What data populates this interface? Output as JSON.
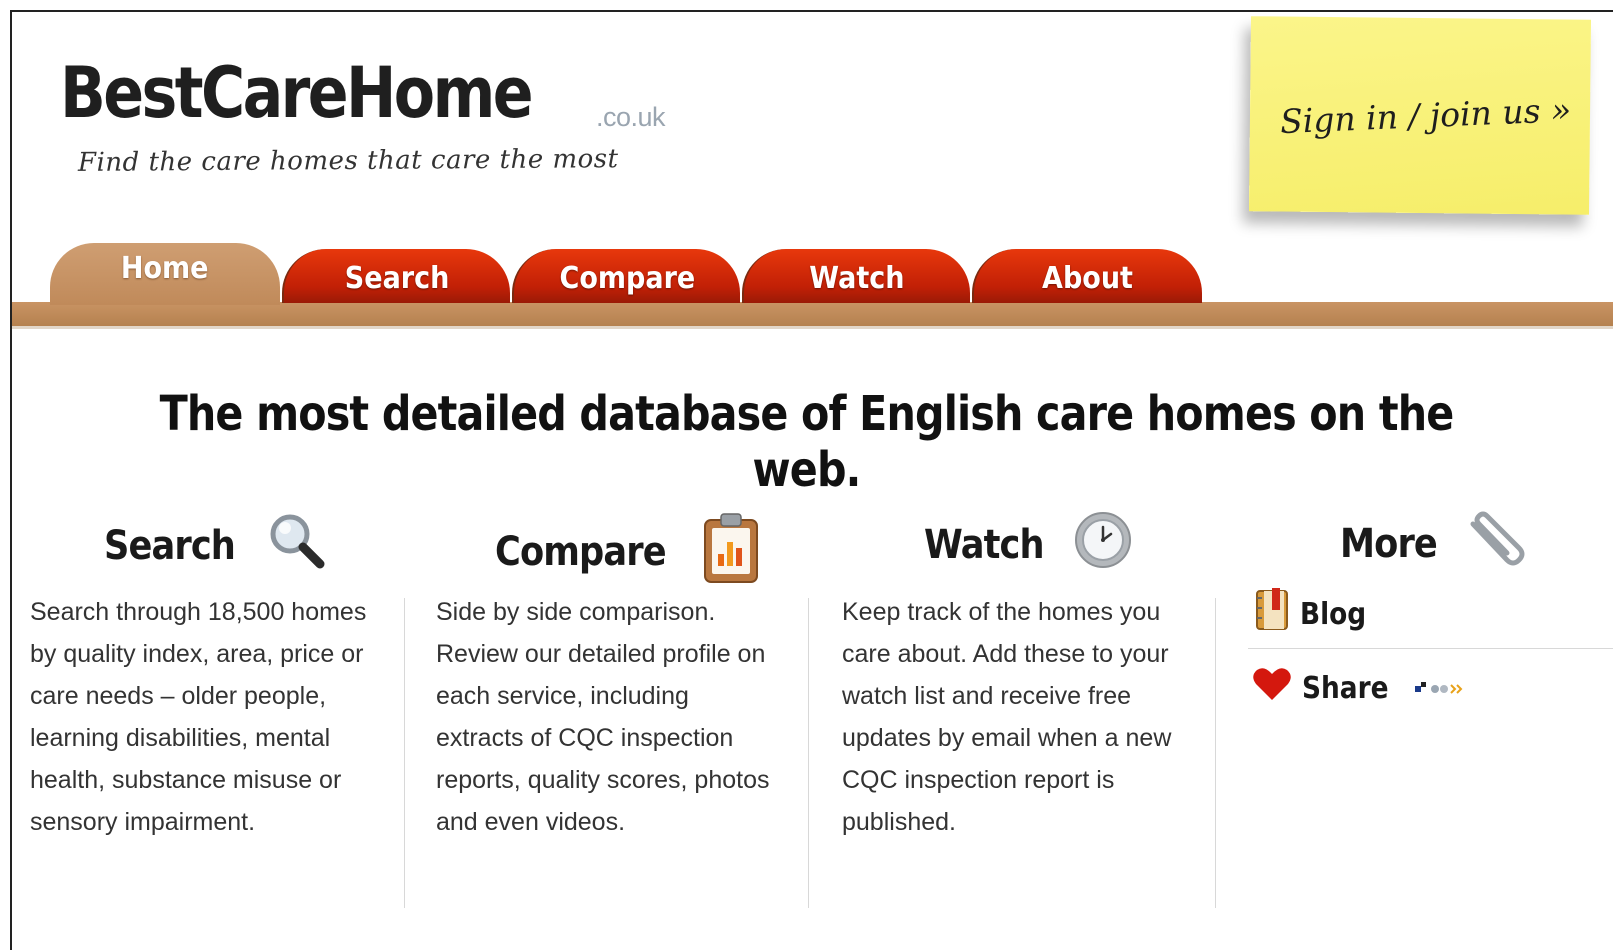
{
  "logo": {
    "main": "BestCareHome",
    "tld": ".co.uk",
    "tagline": "Find the care homes that care the most"
  },
  "signin": {
    "label": "Sign in / join us »"
  },
  "nav": {
    "tabs": [
      {
        "label": "Home",
        "active": true
      },
      {
        "label": "Search"
      },
      {
        "label": "Compare"
      },
      {
        "label": "Watch"
      },
      {
        "label": "About"
      }
    ]
  },
  "headline": "The most detailed database of English care homes on the web.",
  "features": {
    "search": {
      "title": "Search",
      "icon": "magnifier-icon",
      "text": "Search through 18,500 homes by quality index, area, price or care needs – older people, learning disabilities, mental health, substance misuse or sensory impairment."
    },
    "compare": {
      "title": "Compare",
      "icon": "clipboard-chart-icon",
      "text": "Side by side comparison. Review our detailed profile on each service, including extracts of CQC inspection reports, quality scores, photos and even videos."
    },
    "watch": {
      "title": "Watch",
      "icon": "clock-icon",
      "text": "Keep track of the homes you care about. Add these to your watch list and receive free updates by email when a new CQC inspection report is published."
    },
    "more": {
      "title": "More",
      "icon": "paperclip-icon",
      "blog": "Blog",
      "share": "Share"
    }
  },
  "colors": {
    "tab_red": "#d02a08",
    "tab_active": "#c8956a",
    "sticky": "#f8f07a",
    "text": "#333333"
  }
}
